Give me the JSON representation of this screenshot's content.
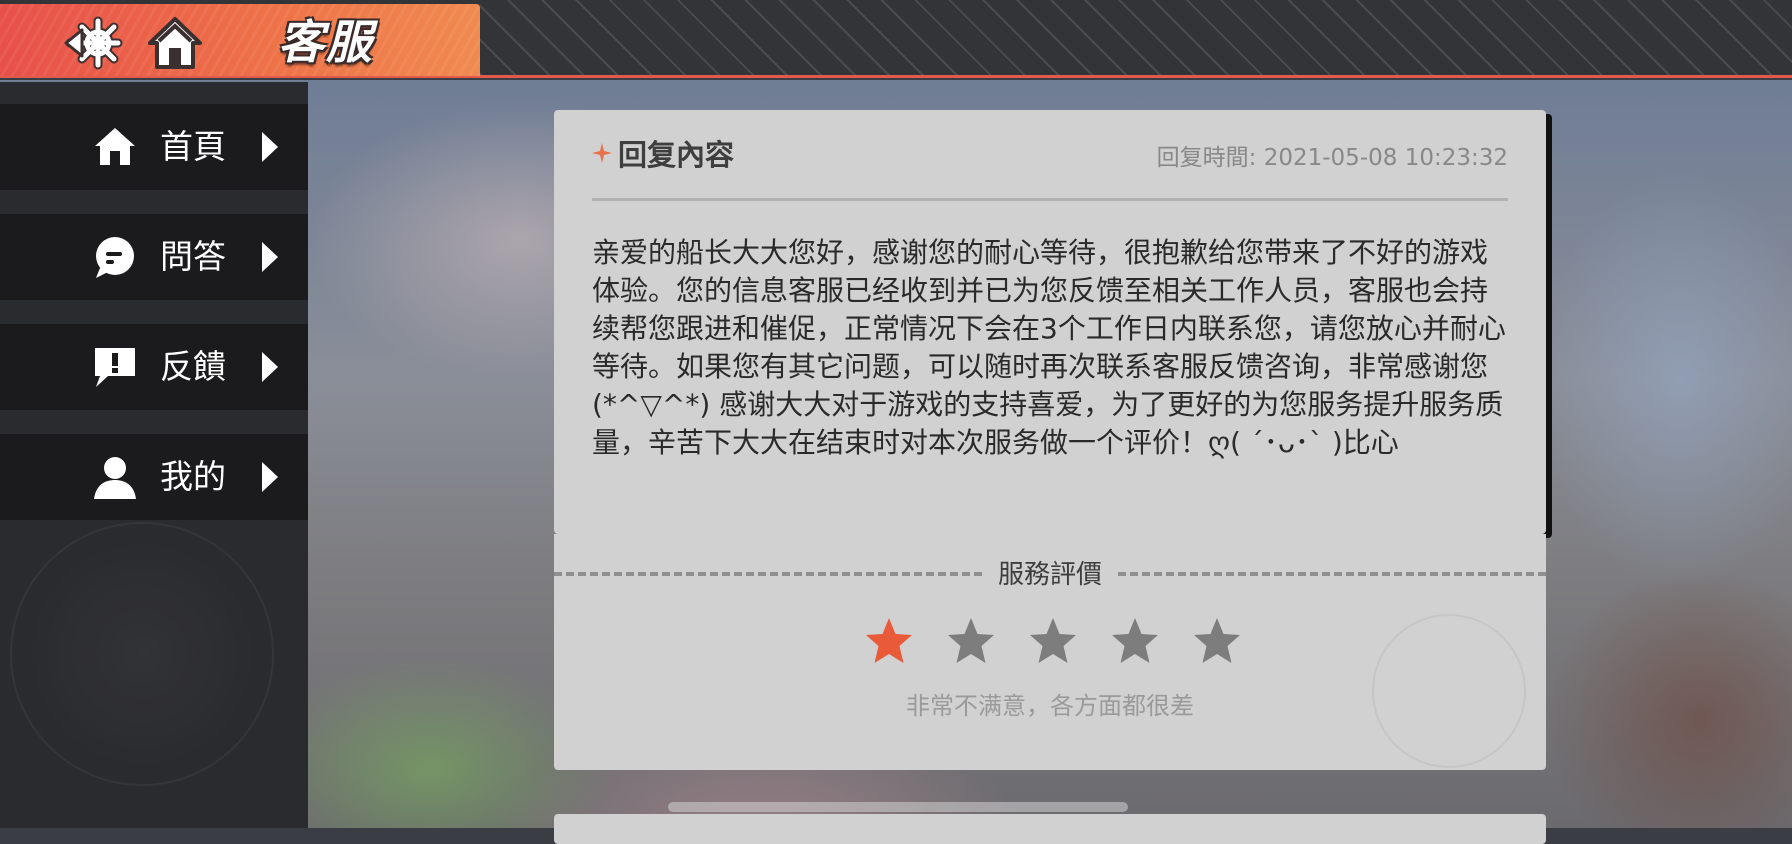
{
  "header": {
    "title": "客服",
    "back_icon": "helm-back-icon",
    "home_icon": "home-icon",
    "accent_color": "#e8504a"
  },
  "sidebar": {
    "items": [
      {
        "label": "首頁",
        "icon": "home-icon"
      },
      {
        "label": "問答",
        "icon": "chat-bubble-icon"
      },
      {
        "label": "反饋",
        "icon": "exclamation-bubble-icon"
      },
      {
        "label": "我的",
        "icon": "user-icon"
      }
    ]
  },
  "reply": {
    "title": "回复內容",
    "time": "回复時間: 2021-05-08 10:23:32",
    "body": "亲爱的船长大大您好，感谢您的耐心等待，很抱歉给您带来了不好的游戏体验。您的信息客服已经收到并已为您反馈至相关工作人员，客服也会持续帮您跟进和催促，正常情况下会在3个工作日内联系您，请您放心并耐心等待。如果您有其它问题，可以随时再次联系客服反馈咨询，非常感谢您(*^▽^*) 感谢大大对于游戏的支持喜爱，为了更好的为您服务提升服务质量，辛苦下大大在结束时对本次服务做一个评价！ღ( ´･ᴗ･` )比心"
  },
  "rating": {
    "title": "服務評價",
    "value": 1,
    "max": 5,
    "description": "非常不满意，各方面都很差",
    "active_color": "#e85a38",
    "inactive_color": "#7d7d7d"
  }
}
